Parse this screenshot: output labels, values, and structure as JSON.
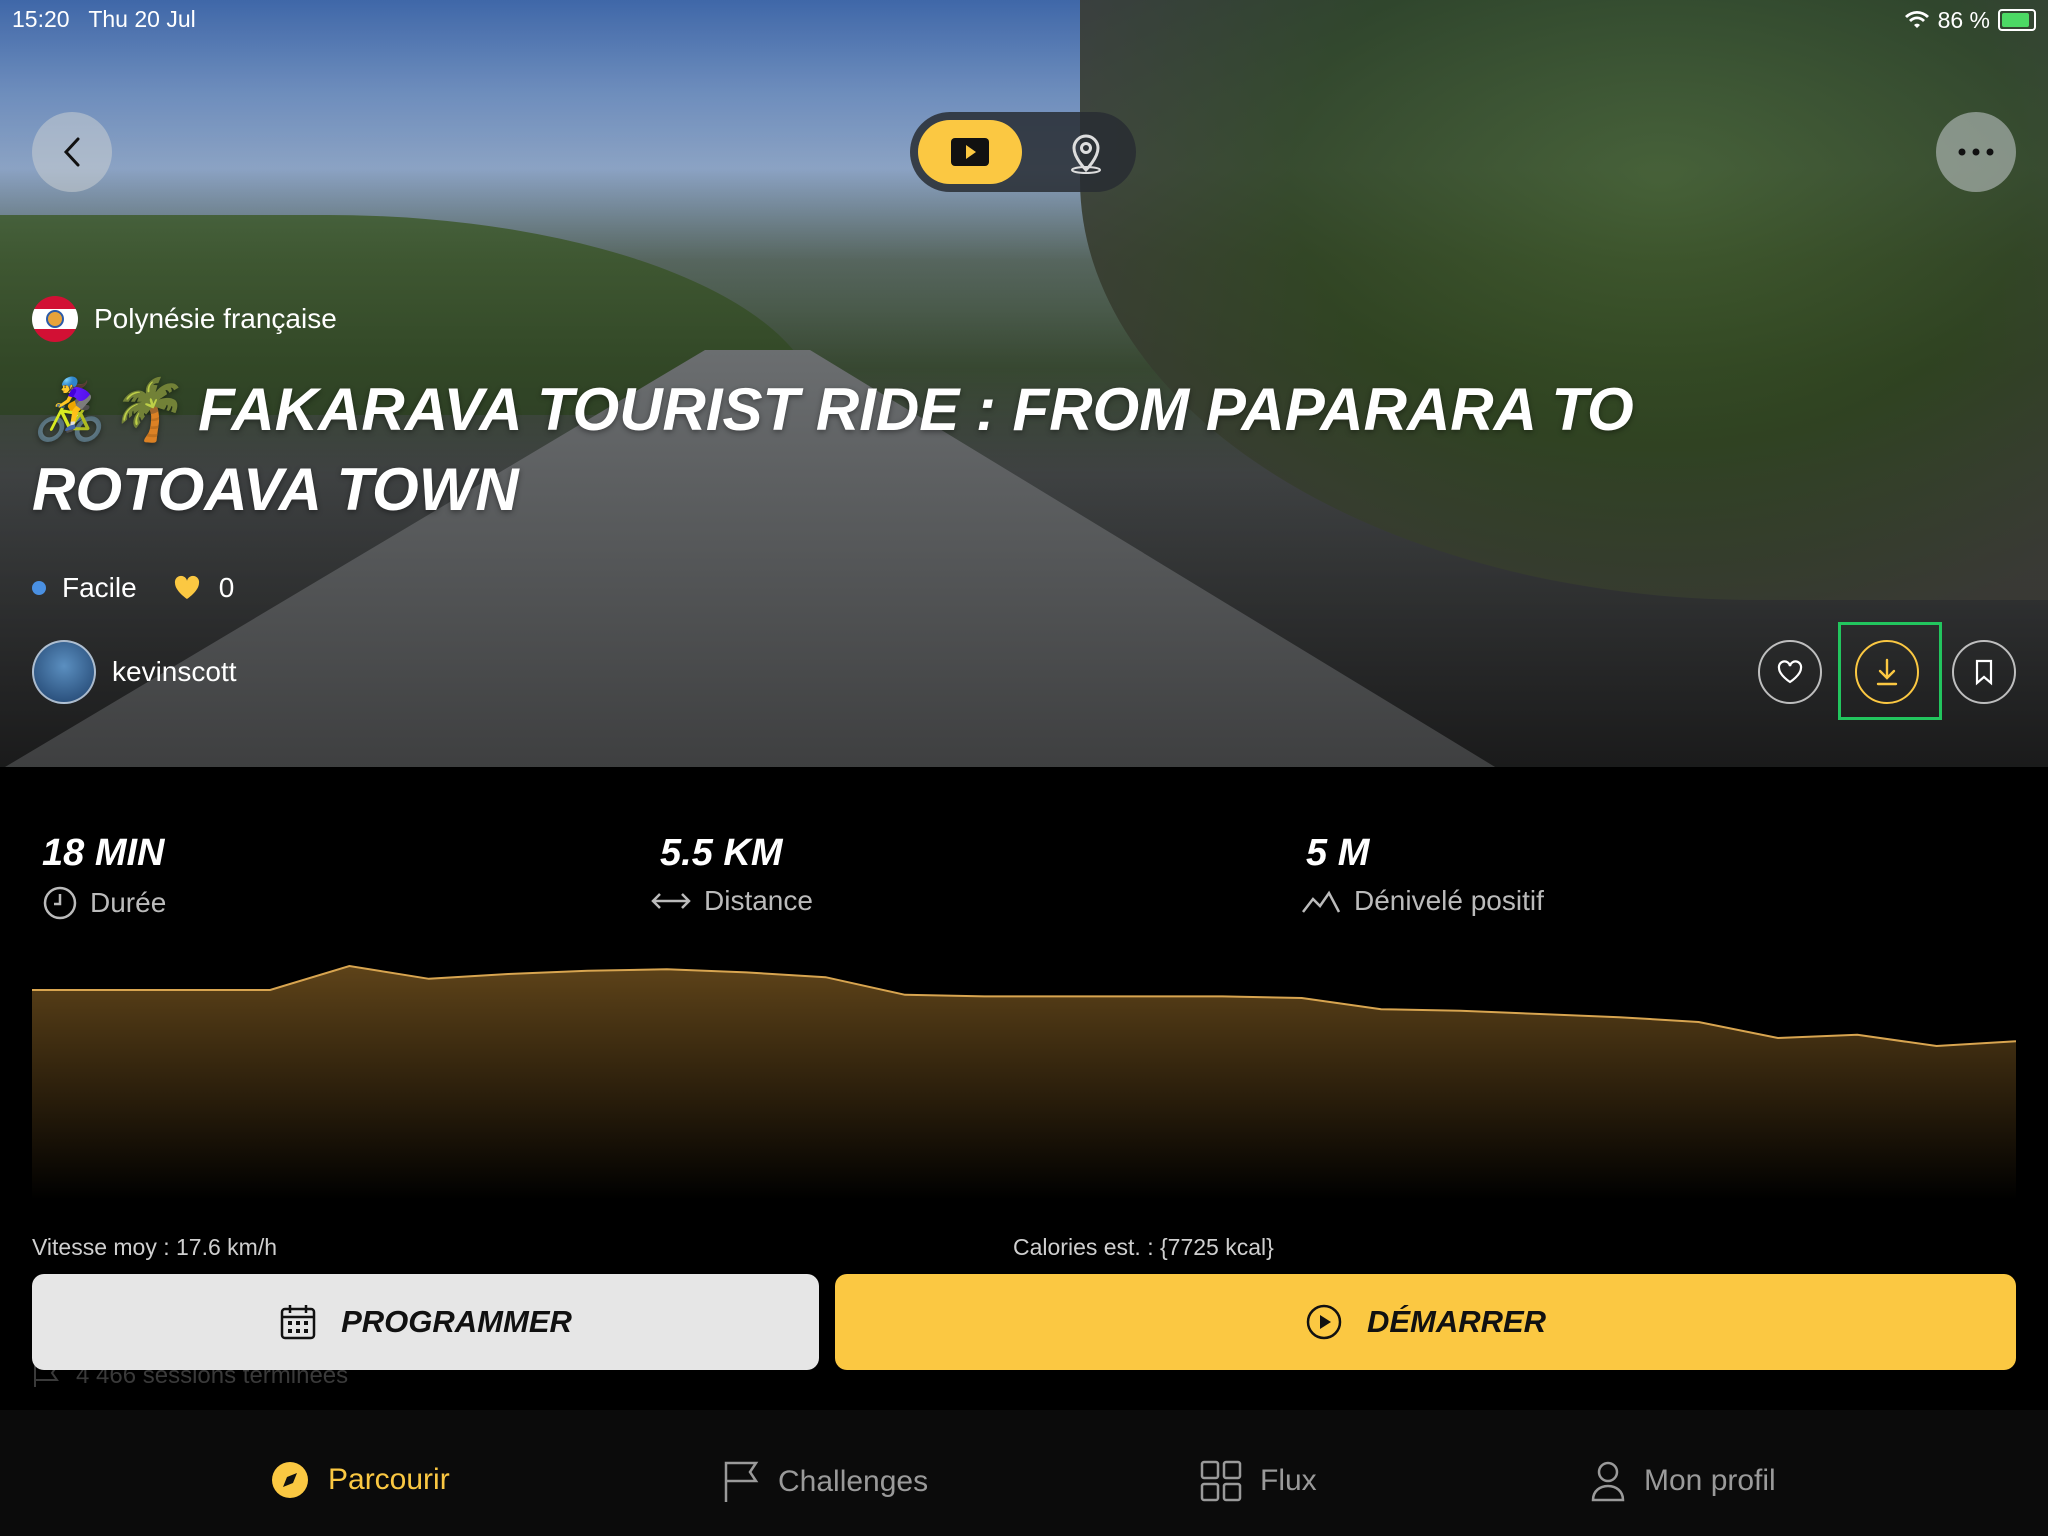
{
  "status": {
    "time": "15:20",
    "date": "Thu 20 Jul",
    "battery": "86 %"
  },
  "colors": {
    "accent": "#fbc842",
    "easy_dot": "#4a90e2",
    "highlight": "#22c55e"
  },
  "toggle": {
    "active": "video",
    "items": [
      "play-icon",
      "map-pin-icon"
    ]
  },
  "route": {
    "country": "Polynésie française",
    "title": "🚴‍♀️🌴 FAKARAVA TOURIST RIDE : FROM PAPARARA TO ROTOAVA TOWN",
    "difficulty": "Facile",
    "likes": "0",
    "author": "kevinscott"
  },
  "stats": [
    {
      "value": "18 MIN",
      "label": "Durée",
      "icon": "clock-icon"
    },
    {
      "value": "5.5 KM",
      "label": "Distance",
      "icon": "distance-arrows-icon"
    },
    {
      "value": "5 M",
      "label": "Dénivelé positif",
      "icon": "elevation-icon"
    }
  ],
  "profile_elevation": [
    0.25,
    0.25,
    0.25,
    0.25,
    0.4,
    0.32,
    0.35,
    0.37,
    0.38,
    0.36,
    0.33,
    0.22,
    0.21,
    0.21,
    0.21,
    0.21,
    0.2,
    0.13,
    0.12,
    0.1,
    0.08,
    0.05,
    -0.05,
    -0.03,
    -0.1,
    -0.07
  ],
  "info": {
    "avg_speed": "Vitesse moy : 17.6 km/h",
    "calories": "Calories est. : {7725 kcal}"
  },
  "buttons": {
    "schedule": "PROGRAMMER",
    "start": "DÉMARRER"
  },
  "sessions": "4 466 sessions terminées",
  "tabs": [
    {
      "label": "Parcourir",
      "icon": "compass-icon",
      "active": true
    },
    {
      "label": "Challenges",
      "icon": "flag-icon",
      "active": false
    },
    {
      "label": "Flux",
      "icon": "grid-icon",
      "active": false
    },
    {
      "label": "Mon profil",
      "icon": "person-icon",
      "active": false
    }
  ]
}
